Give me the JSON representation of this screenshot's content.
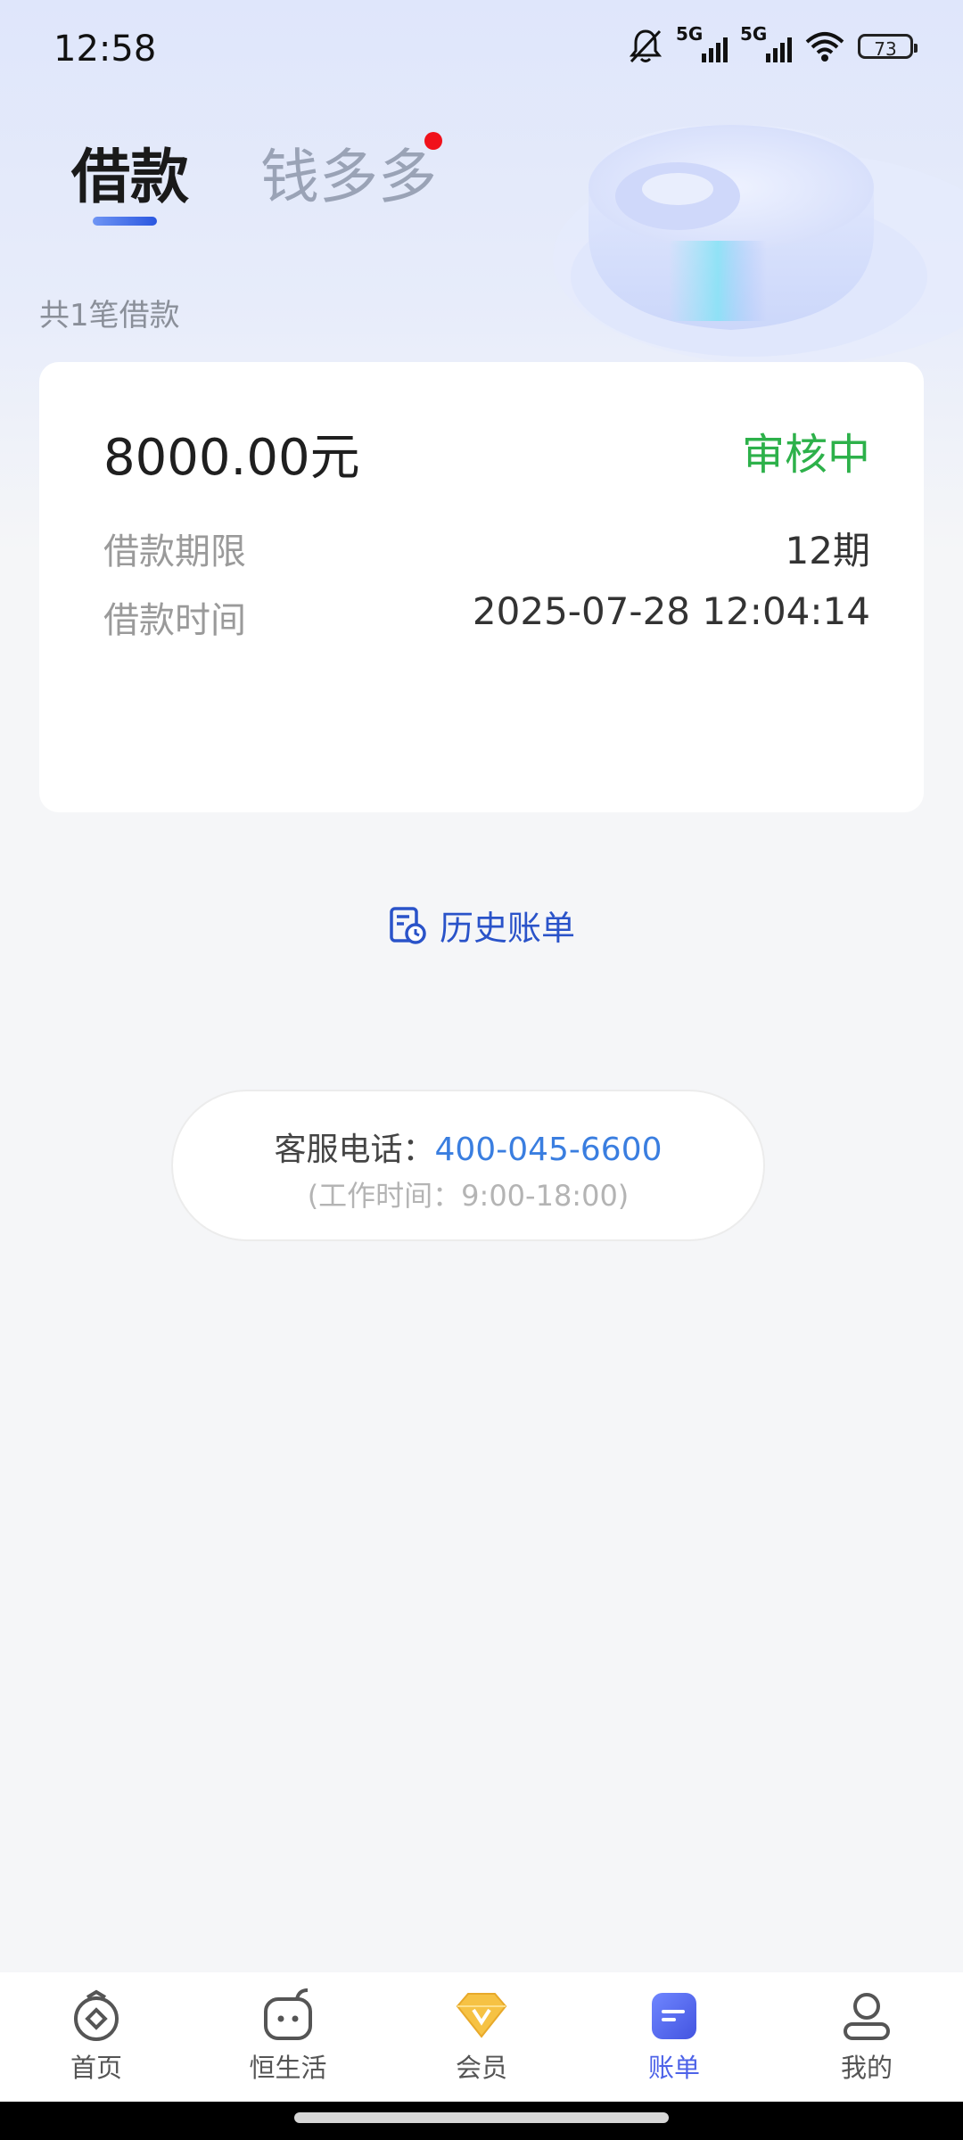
{
  "status_bar": {
    "time": "12:58",
    "net1": "5G",
    "net2": "5G",
    "battery": "73"
  },
  "tabs": [
    {
      "label": "借款",
      "active": true
    },
    {
      "label": "钱多多",
      "active": false,
      "badge_dot": true
    }
  ],
  "loan_count_text": "共1笔借款",
  "loan_card": {
    "amount": "8000.00元",
    "status": "审核中",
    "term_label": "借款期限",
    "term_value": "12期",
    "time_label": "借款时间",
    "time_value": "2025-07-28 12:04:14"
  },
  "history_label": "历史账单",
  "service": {
    "label": "客服电话：",
    "phone": "400-045-6600",
    "hours": "(工作时间：9:00-18:00)"
  },
  "bottom_nav": [
    {
      "label": "首页",
      "icon": "home-icon"
    },
    {
      "label": "恒生活",
      "icon": "life-icon"
    },
    {
      "label": "会员",
      "icon": "member-diamond-icon"
    },
    {
      "label": "账单",
      "icon": "bill-icon",
      "active": true
    },
    {
      "label": "我的",
      "icon": "profile-icon"
    }
  ],
  "colors": {
    "accent": "#4d62e8",
    "status_green": "#2db14a",
    "phone_blue": "#3a7ee0",
    "tab_underline": "#2a57e0",
    "badge_red": "#f0111b"
  }
}
